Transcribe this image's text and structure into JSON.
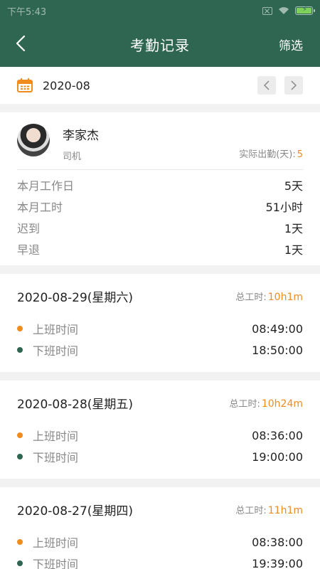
{
  "status_bar": {
    "time": "下午5:43"
  },
  "navbar": {
    "title": "考勤记录",
    "filter_label": "筛选"
  },
  "month": {
    "value": "2020-08"
  },
  "profile": {
    "name": "李家杰",
    "role": "司机",
    "actual_label": "实际出勤(天):",
    "actual_value": "5"
  },
  "stats": [
    {
      "label": "本月工作日",
      "value": "5天"
    },
    {
      "label": "本月工时",
      "value": "51小时"
    },
    {
      "label": "迟到",
      "value": "1天"
    },
    {
      "label": "早退",
      "value": "1天"
    }
  ],
  "days": [
    {
      "date": "2020-08-29(星期六)",
      "total_label": "总工时:",
      "total_value": "10h1m",
      "in_label": "上班时间",
      "in_time": "08:49:00",
      "out_label": "下班时间",
      "out_time": "18:50:00"
    },
    {
      "date": "2020-08-28(星期五)",
      "total_label": "总工时:",
      "total_value": "10h24m",
      "in_label": "上班时间",
      "in_time": "08:36:00",
      "out_label": "下班时间",
      "out_time": "19:00:00"
    },
    {
      "date": "2020-08-27(星期四)",
      "total_label": "总工时:",
      "total_value": "11h1m",
      "in_label": "上班时间",
      "in_time": "08:38:00",
      "out_label": "下班时间",
      "out_time": "19:39:00"
    }
  ],
  "colors": {
    "primary": "#2f6652",
    "accent": "#f08c1e",
    "clock_in_dot": "#f08c1e",
    "clock_out_dot": "#2f6652"
  },
  "icons": [
    "back-arrow-icon",
    "calendar-icon",
    "chevron-left-icon",
    "chevron-right-icon",
    "wifi-icon",
    "battery-icon",
    "sim-icon"
  ]
}
